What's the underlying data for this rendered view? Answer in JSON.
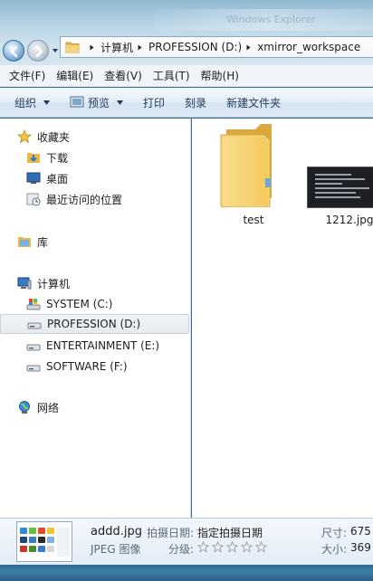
{
  "titlebar": {
    "ghost_text": "Windows Explorer"
  },
  "address": {
    "crumbs": [
      "计算机",
      "PROFESSION (D:)",
      "xmirror_workspace"
    ]
  },
  "menu": [
    "文件(F)",
    "编辑(E)",
    "查看(V)",
    "工具(T)",
    "帮助(H)"
  ],
  "commands": {
    "organize": "组织",
    "preview": "预览",
    "print": "打印",
    "burn": "刻录",
    "new_folder": "新建文件夹"
  },
  "nav": {
    "favorites": "收藏夹",
    "downloads": "下载",
    "desktop": "桌面",
    "recent": "最近访问的位置",
    "libraries": "库",
    "computer": "计算机",
    "drives": [
      "SYSTEM (C:)",
      "PROFESSION (D:)",
      "ENTERTAINMENT (E:)",
      "SOFTWARE (F:)"
    ],
    "network": "网络",
    "selected_drive": "PROFESSION (D:)"
  },
  "files": [
    {
      "name": "test",
      "type": "folder"
    },
    {
      "name": "1212.jpg",
      "type": "image"
    }
  ],
  "details": {
    "filename": "addd.jpg",
    "filetype": "JPEG 图像",
    "date_label": "拍摄日期:",
    "date_value": "指定拍摄日期",
    "rating_label": "分级:",
    "rating": 0,
    "dim_label": "尺寸:",
    "dim_value": "675",
    "size_label": "大小:",
    "size_value": "369"
  },
  "colors": {
    "accent": "#2f6f9a",
    "selection": "#e6ebf0",
    "folder": "#f2c94c"
  }
}
